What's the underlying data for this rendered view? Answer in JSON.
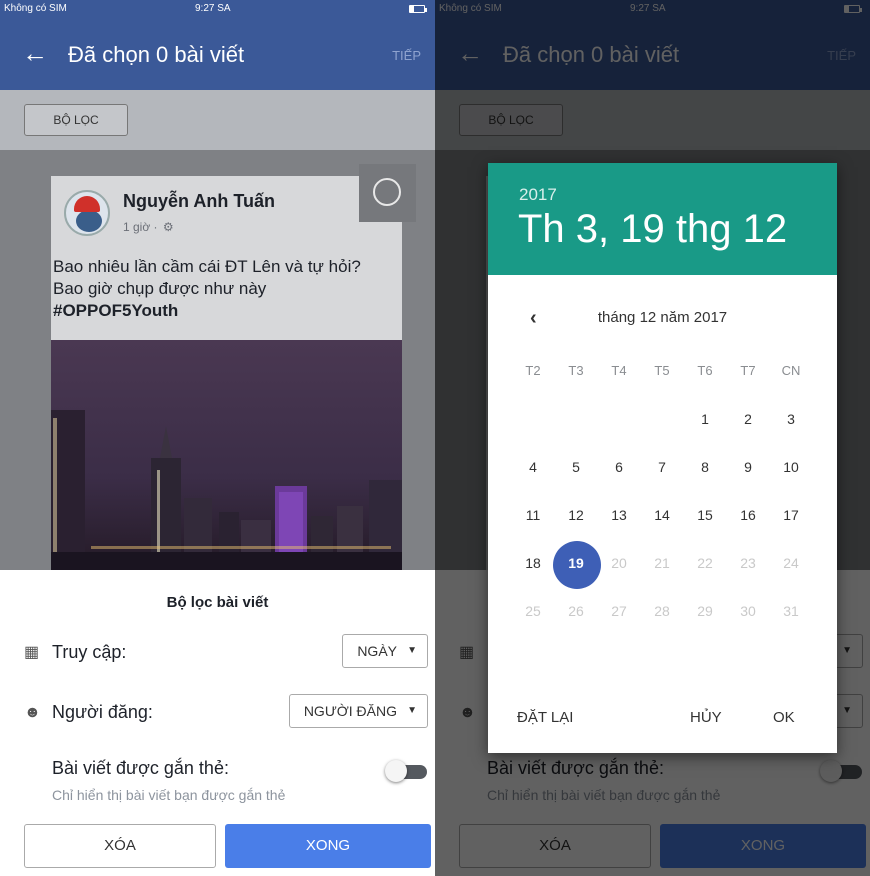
{
  "status": {
    "carrier": "Không có SIM",
    "time": "9:27 SA"
  },
  "nav": {
    "title": "Đã chọn 0 bài viết",
    "next": "TIẾP"
  },
  "filter_chip": "BỘ LỌC",
  "post": {
    "author": "Nguyễn Anh Tuấn",
    "meta": "1 giờ ·",
    "text": "Bao nhiêu lần cầm cái ĐT Lên và tự hỏi? Bao giờ chụp được như này",
    "hashtag": "#OPPOF5Youth"
  },
  "sheet": {
    "title": "Bộ lọc bài viết",
    "access_label": "Truy cập:",
    "access_value": "NGÀY",
    "poster_label": "Người đăng:",
    "poster_value": "NGƯỜI ĐĂNG",
    "tagged_title": "Bài viết được gắn thẻ:",
    "tagged_sub": "Chỉ hiển thị bài viết bạn được gắn thẻ",
    "tagged_enabled": false,
    "clear": "XÓA",
    "done": "XONG"
  },
  "date_picker": {
    "year": "2017",
    "date": "Th 3, 19 thg 12",
    "month": "tháng 12 năm 2017",
    "weekdays": [
      "T2",
      "T3",
      "T4",
      "T5",
      "T6",
      "T7",
      "CN"
    ],
    "week1": [
      "1",
      "2",
      "3"
    ],
    "week2": [
      "4",
      "5",
      "6",
      "7",
      "8",
      "9",
      "10"
    ],
    "week3": [
      "11",
      "12",
      "13",
      "14",
      "15",
      "16",
      "17"
    ],
    "week4": [
      "18",
      "19",
      "20",
      "21",
      "22",
      "23",
      "24"
    ],
    "week5": [
      "25",
      "26",
      "27",
      "28",
      "29",
      "30",
      "31"
    ],
    "selected_day": "19",
    "reset": "ĐẶT LẠI",
    "cancel": "HỦY",
    "ok": "OK"
  },
  "icons": {
    "back": "arrow-left-icon",
    "settings": "gear-icon",
    "calendar": "calendar-grid-icon",
    "person": "person-icon",
    "caret": "caret-down-icon",
    "prev": "chevron-left-icon"
  },
  "colors": {
    "facebook_blue": "#3b5998",
    "primary_button": "#4a7ee8",
    "picker_header": "#199a87",
    "selected_day": "#3e5fb6"
  }
}
